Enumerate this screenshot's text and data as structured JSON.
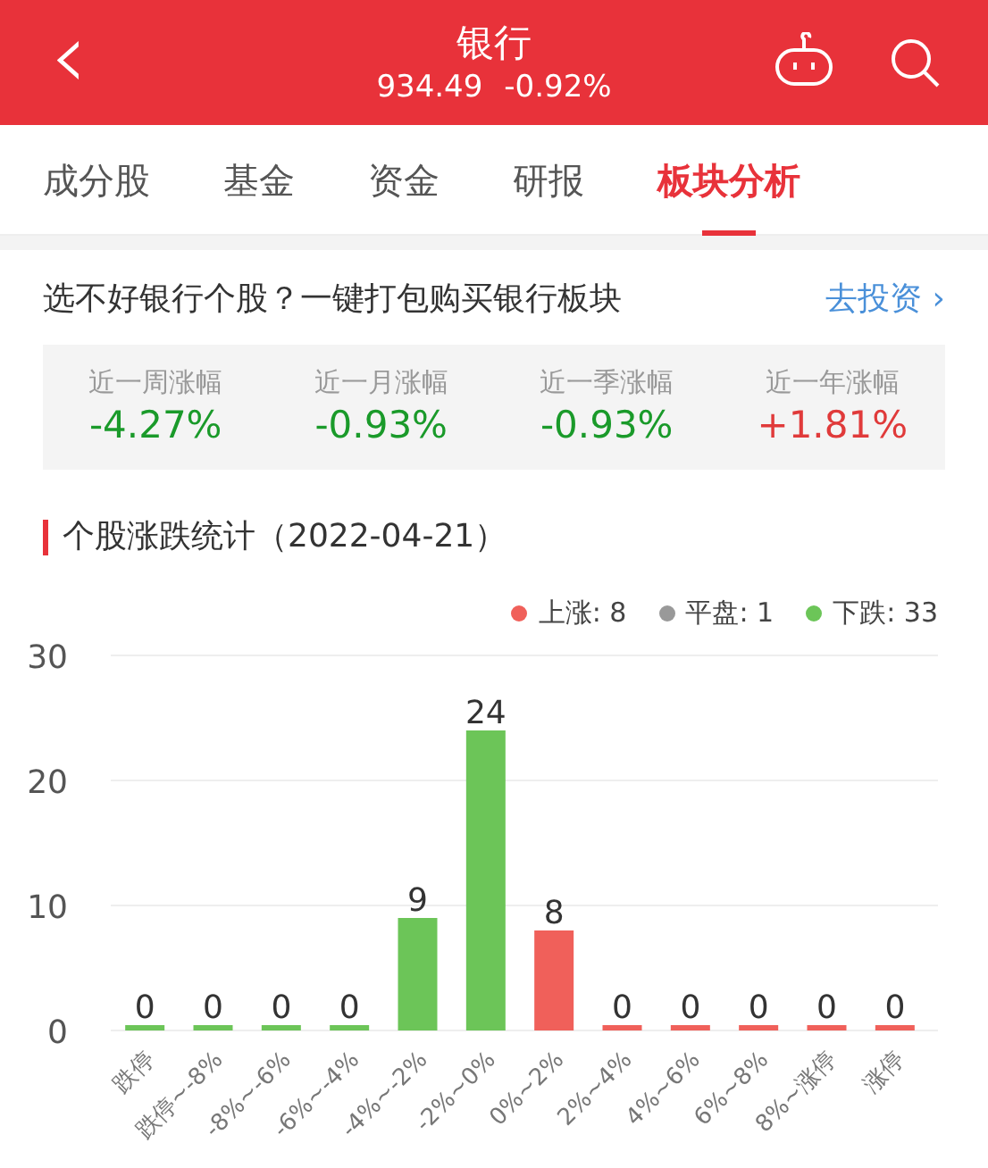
{
  "header": {
    "back_icon": "‹",
    "title": "银行",
    "price": "934.49",
    "change": "-0.92%"
  },
  "tabs": [
    {
      "label": "成分股",
      "selected": false
    },
    {
      "label": "基金",
      "selected": false
    },
    {
      "label": "资金",
      "selected": false
    },
    {
      "label": "研报",
      "selected": false
    },
    {
      "label": "板块分析",
      "selected": true
    }
  ],
  "promo": {
    "text": "选不好银行个股？一键打包购买银行板块",
    "link": "去投资",
    "link_arrow": "›"
  },
  "returns": [
    {
      "label": "近一周涨幅",
      "value": "-4.27%",
      "color": "#1a9a2a"
    },
    {
      "label": "近一月涨幅",
      "value": "-0.93%",
      "color": "#1a9a2a"
    },
    {
      "label": "近一季涨幅",
      "value": "-0.93%",
      "color": "#1a9a2a"
    },
    {
      "label": "近一年涨幅",
      "value": "+1.81%",
      "color": "#e03a3a"
    }
  ],
  "section_title": "个股涨跌统计（2022-04-21）",
  "legend": [
    {
      "label": "上涨: 8",
      "color": "#f0605a"
    },
    {
      "label": "平盘: 1",
      "color": "#999999"
    },
    {
      "label": "下跌: 33",
      "color": "#6cc558"
    }
  ],
  "chart_data": {
    "type": "bar",
    "data_labels": true,
    "ylim": [
      0,
      30
    ],
    "yticks": [
      0,
      10,
      20,
      30
    ],
    "categories": [
      "跌停",
      "跌停~-8%",
      "-8%~-6%",
      "-6%~-4%",
      "-4%~-2%",
      "-2%~0%",
      "0%~2%",
      "2%~4%",
      "4%~6%",
      "6%~8%",
      "8%~涨停",
      "涨停"
    ],
    "series": [
      {
        "color": "#6cc558",
        "values": [
          0,
          0,
          0,
          0,
          9,
          24,
          null,
          null,
          null,
          null,
          null,
          null
        ]
      },
      {
        "color": "#f0605a",
        "values": [
          null,
          null,
          null,
          null,
          null,
          null,
          8,
          0,
          0,
          0,
          0,
          0
        ]
      }
    ]
  }
}
